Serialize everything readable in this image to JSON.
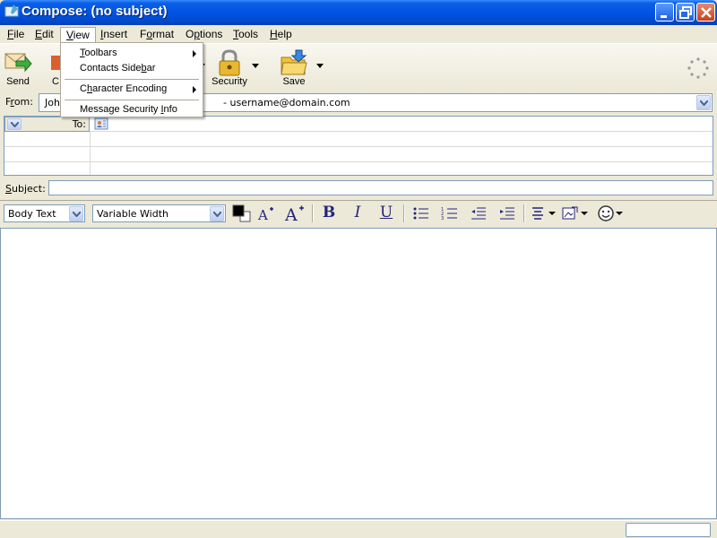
{
  "window": {
    "title": "Compose: (no subject)",
    "icon": "thunderbird-compose-icon"
  },
  "menubar": {
    "items": [
      {
        "key": "F",
        "rest": "ile"
      },
      {
        "key": "E",
        "rest": "dit"
      },
      {
        "key": "V",
        "rest": "iew"
      },
      {
        "key": "I",
        "rest": "nsert"
      },
      {
        "pre": "F",
        "key": "o",
        "rest": "rmat"
      },
      {
        "pre": "O",
        "key": "p",
        "rest": "tions"
      },
      {
        "key": "T",
        "rest": "ools"
      },
      {
        "key": "H",
        "rest": "elp"
      }
    ]
  },
  "view_menu": {
    "items": [
      {
        "key": "T",
        "rest": "oolbars"
      },
      {
        "pre": "Contacts Side",
        "key": "b",
        "rest": "ar"
      },
      {
        "pre": "C",
        "key": "h",
        "rest": "aracter Encoding"
      },
      {
        "pre": "Message Security ",
        "key": "I",
        "rest": "nfo"
      }
    ]
  },
  "toolbar": {
    "send": "Send",
    "contacts_partial": "C",
    "security": "Security",
    "save": "Save"
  },
  "from": {
    "label_key": "r",
    "label_pre": "F",
    "label_rest": "om:",
    "value_partial": "Joh",
    "value_rest": "- username@domain.com"
  },
  "addressing": {
    "type": "To:"
  },
  "subject": {
    "label_key": "S",
    "label_rest": "ubject:",
    "value": ""
  },
  "format_bar": {
    "paragraph_style": "Body Text",
    "font": "Variable Width",
    "bold": "B",
    "italic": "I",
    "underline": "U",
    "text_color": "#000000"
  }
}
